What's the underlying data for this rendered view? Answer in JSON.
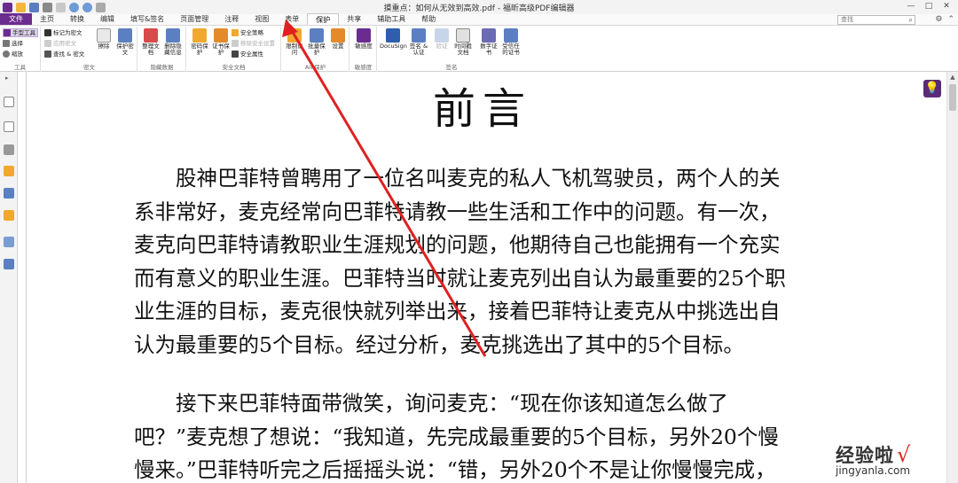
{
  "window": {
    "title": "摸重点：如何从无效到高效.pdf - 福昕高级PDF编辑器",
    "controls": [
      "—",
      "□",
      "✕"
    ]
  },
  "menu": {
    "file": "文件",
    "tabs": [
      "主页",
      "转换",
      "编辑",
      "填写&签名",
      "页面管理",
      "注释",
      "视图",
      "表单",
      "保护",
      "共享",
      "辅助工具",
      "帮助"
    ],
    "active_tab": "保护",
    "search_placeholder": "查找"
  },
  "ribbon": {
    "tools": {
      "hand": "手型工具",
      "select": "选择",
      "zoom": "缩放",
      "label": "工具"
    },
    "redact": {
      "mark": "标记为密文",
      "apply": "应用密文",
      "find_redact": "查找 & 密文",
      "erase": "擦除",
      "protect": "保护密文",
      "label": "密文"
    },
    "hidden": {
      "clean": "整理文档",
      "remove": "删除隐藏信息",
      "label": "隐藏数据"
    },
    "security": {
      "password": "密码保护",
      "certificate": "证书保护",
      "policy": "安全策略",
      "remove_security": "移除安全设置",
      "properties": "安全属性",
      "label": "安全文档"
    },
    "aip": {
      "access": "限制访问",
      "batch": "批量保护",
      "settings": "设置",
      "label": "AIP保护"
    },
    "sensitivity": {
      "label_btn": "敏感度",
      "label": "敏感度"
    },
    "sign": {
      "docusign": "DocuSign",
      "sign_cert": "签名 & 认证",
      "validate": "验证",
      "timestamp": "时间戳文档",
      "digital_id": "数字证书",
      "trusted": "受信任的证书",
      "label": "签名"
    }
  },
  "document": {
    "title": "前言",
    "paragraph1": [
      "股神巴菲特曾聘用了一位名叫麦克的私人飞机驾驶员，两个人的关",
      "系非常好，麦克经常向巴菲特请教一些生活和工作中的问题。有一次，",
      "麦克向巴菲特请教职业生涯规划的问题，他期待自己也能拥有一个充实",
      "而有意义的职业生涯。巴菲特当时就让麦克列出自认为最重要的25个职",
      "业生涯的目标，麦克很快就列举出来，接着巴菲特让麦克从中挑选出自",
      "认为最重要的5个目标。经过分析，麦克挑选出了其中的5个目标。"
    ],
    "paragraph2": [
      "接下来巴菲特面带微笑，询问麦克：“现在你该知道怎么做了",
      "吧？”麦克想了想说：“我知道，先完成最重要的5个目标，另外20个慢",
      "慢来。”巴菲特听完之后摇摇头说：“错，另外20个不是让你慢慢完成，"
    ]
  },
  "watermark": {
    "brand": "经验啦",
    "check": "√",
    "url": "jingyanla.com"
  },
  "colors": {
    "brand": "#6b2c8f",
    "arrow": "#e02020"
  },
  "icons": [
    "app-logo-icon",
    "open-icon",
    "save-icon",
    "print-icon",
    "undo-icon",
    "redo-icon",
    "hand-icon",
    "lightbulb-icon",
    "search-icon"
  ]
}
